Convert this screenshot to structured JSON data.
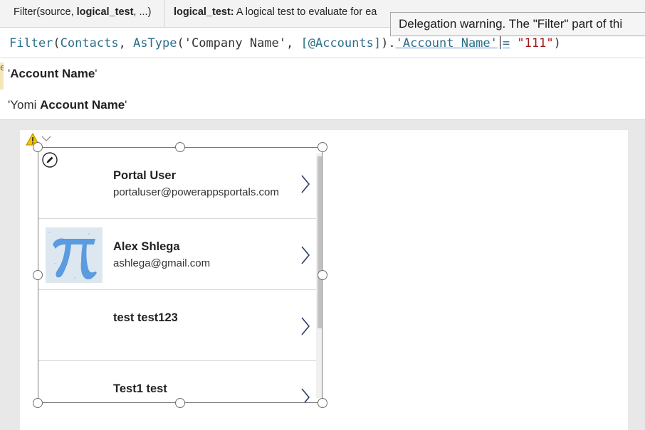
{
  "hint": {
    "signature_prefix": "Filter(source, ",
    "signature_bold": "logical_test",
    "signature_suffix": ", ...)",
    "param_name": "logical_test:",
    "param_desc": " A logical test to evaluate for ea"
  },
  "tooltip": {
    "text": "Delegation warning. The \"Filter\" part of thi"
  },
  "formula": {
    "fn": "Filter",
    "open": "(",
    "source": "Contacts",
    "sep1": ", ",
    "fn2": "AsType",
    "open2": "(",
    "str1": "'Company Name'",
    "sep2": ", ",
    "tbl": "[@Accounts]",
    "close2": ")",
    "dot": ".",
    "field": "'Account Name'",
    "eq": "=",
    "str2": "\"111\"",
    "close": ")"
  },
  "intellisense": {
    "items": [
      {
        "prefix": "'",
        "bold": "Account Name",
        "suffix": "'"
      },
      {
        "prefix": "'Yomi ",
        "bold": "Account Name",
        "suffix": "'"
      }
    ],
    "marker": "e"
  },
  "gallery": {
    "rows": [
      {
        "title": "Portal User",
        "subtitle": "portaluser@powerappsportals.com"
      },
      {
        "title": "Alex Shlega",
        "subtitle": "ashlega@gmail.com"
      },
      {
        "title": "test test123",
        "subtitle": ""
      },
      {
        "title": "Test1 test",
        "subtitle": ""
      }
    ]
  },
  "icons": {
    "warning": "warning-icon",
    "edit": "pencil-edit-icon",
    "chevron": "chevron-right-icon",
    "dropdown": "chevron-down-icon"
  },
  "colors": {
    "accent": "#2c6e8a",
    "string": "#a31515",
    "warning": "#f5c400"
  }
}
